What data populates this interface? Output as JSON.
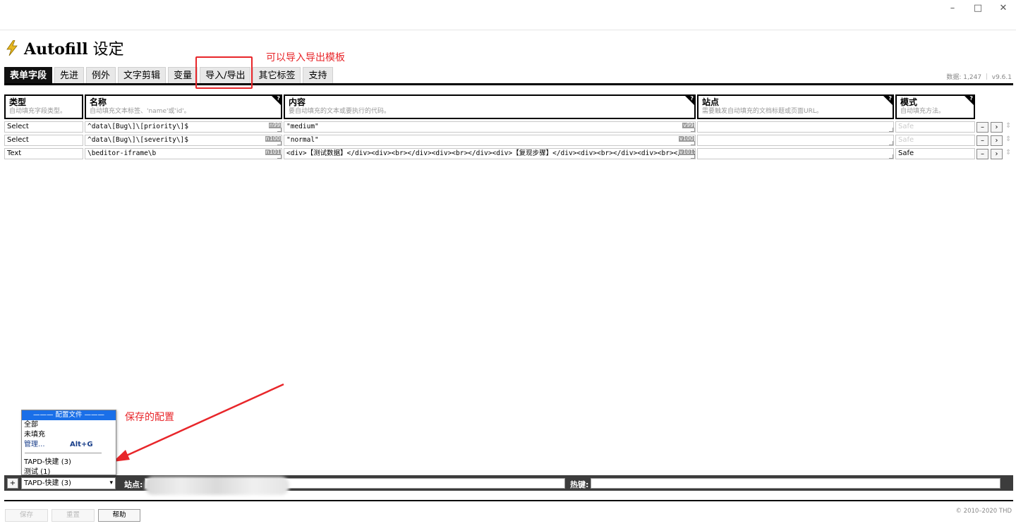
{
  "window": {
    "minimize": "–",
    "maximize": "□",
    "close": "✕"
  },
  "app": {
    "title_bold": "Autofill",
    "title_rest": " 设定"
  },
  "tabs": [
    {
      "label": "表单字段",
      "active": true
    },
    {
      "label": "先进"
    },
    {
      "label": "例外"
    },
    {
      "label": "文字剪辑"
    },
    {
      "label": "变量"
    },
    {
      "label": "导入/导出"
    },
    {
      "label": "其它标签"
    },
    {
      "label": "支持"
    }
  ],
  "stats": "数据: 1,247 ｜ v9.6.1",
  "annotations": {
    "import_export": "可以导入导出模板",
    "saved_config": "保存的配置",
    "color": "#e8262a"
  },
  "columns": {
    "type": {
      "title": "类型",
      "sub": "自动填充字段类型。"
    },
    "name": {
      "title": "名称",
      "sub": "自动填充文本标签、'name'或'id'。"
    },
    "content": {
      "title": "内容",
      "sub": "要自动填充的文本或要执行的代码。"
    },
    "site": {
      "title": "站点",
      "sub": "需要触发自动填充的文档标题或页面URL。"
    },
    "mode": {
      "title": "模式",
      "sub": "自动填充方法。"
    },
    "help_mark": "?"
  },
  "rows": [
    {
      "type": "Select",
      "name": "^data\\[Bug\\]\\[priority\\]$",
      "name_tag": "n99",
      "content": "\"medium\"",
      "content_tag": "v99",
      "site": "",
      "mode": "Safe",
      "mode_muted": true
    },
    {
      "type": "Select",
      "name": "^data\\[Bug\\]\\[severity\\]$",
      "name_tag": "n100",
      "content": "\"normal\"",
      "content_tag": "v100",
      "site": "",
      "mode": "Safe",
      "mode_muted": true
    },
    {
      "type": "Text",
      "name": "\\beditor-iframe\\b",
      "name_tag": "n101",
      "content": "<div>【测试数据】</div><div><br></div><div><br></div><div>【复现步骤】</div><div><br></div><div><br></div>",
      "content_tag": "v101",
      "site": "",
      "mode": "Safe",
      "mode_muted": false
    }
  ],
  "row_buttons": {
    "minus": "–",
    "next": "›",
    "drag": "⇕"
  },
  "dropdown": {
    "header": "——— 配置文件 ———",
    "items": [
      "全部",
      "未填充"
    ],
    "manage": "管理...",
    "manage_shortcut": "Alt+G",
    "profiles": [
      "TAPD-快建 (3)",
      "测试 (1)"
    ]
  },
  "bottom_bar": {
    "plus": "+",
    "selected_profile": "TAPD-快建 (3)",
    "site_label": "站点:",
    "hotkey_label": "热键:"
  },
  "footer": {
    "save": "保存",
    "reset": "重置",
    "help": "帮助",
    "copyright": "© 2010–2020 THD"
  }
}
